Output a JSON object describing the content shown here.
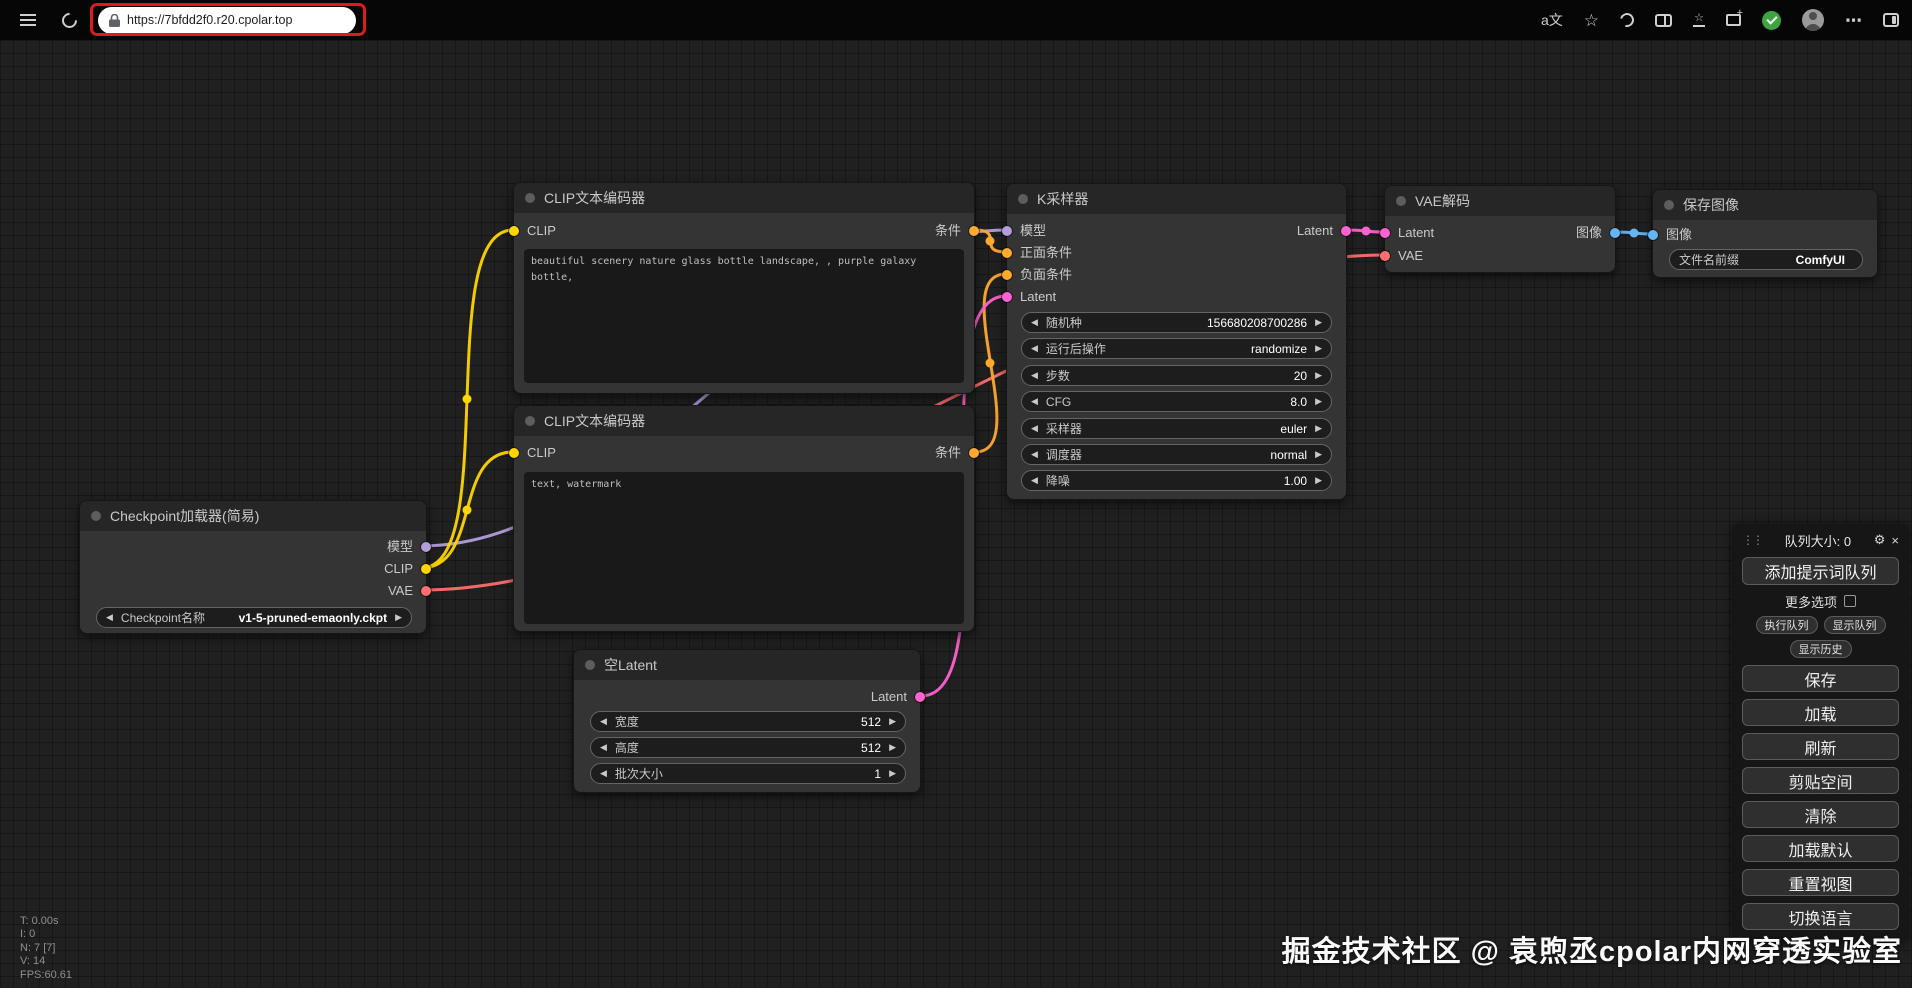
{
  "browser": {
    "url": "https://7bfdd2f0.r20.cpolar.top"
  },
  "glyphs": {
    "arrow_left": "◀",
    "arrow_right": "▶",
    "drag_handle": "⋮⋮",
    "gear": "⚙",
    "close": "×",
    "translate": "a文",
    "star": "☆",
    "more": "⋯"
  },
  "graph": {
    "link_colors": {
      "model": "#B39DDB",
      "clip": "#FFD500",
      "vae": "#FF6E6E",
      "conditioning": "#FFA931",
      "latent": "#FF61D0",
      "image": "#64B5F6"
    },
    "nodes": {
      "checkpoint": {
        "title": "Checkpoint加载器(简易)",
        "outputs": [
          "模型",
          "CLIP",
          "VAE"
        ],
        "widget": {
          "label": "Checkpoint名称",
          "value": "v1-5-pruned-emaonly.ckpt"
        }
      },
      "clip_positive": {
        "title": "CLIP文本编码器",
        "input": "CLIP",
        "output": "条件",
        "text": "beautiful scenery nature glass bottle landscape, , purple galaxy bottle,"
      },
      "clip_negative": {
        "title": "CLIP文本编码器",
        "input": "CLIP",
        "output": "条件",
        "text": "text, watermark"
      },
      "ksampler": {
        "title": "K采样器",
        "inputs": [
          "模型",
          "正面条件",
          "负面条件",
          "Latent"
        ],
        "output": "Latent",
        "widgets": [
          {
            "label": "随机种",
            "value": "156680208700286"
          },
          {
            "label": "运行后操作",
            "value": "randomize"
          },
          {
            "label": "步数",
            "value": "20"
          },
          {
            "label": "CFG",
            "value": "8.0"
          },
          {
            "label": "采样器",
            "value": "euler"
          },
          {
            "label": "调度器",
            "value": "normal"
          },
          {
            "label": "降噪",
            "value": "1.00"
          }
        ]
      },
      "vae_decode": {
        "title": "VAE解码",
        "inputs": [
          "Latent",
          "VAE"
        ],
        "output": "图像"
      },
      "save_image": {
        "title": "保存图像",
        "input": "图像",
        "widget": {
          "label": "文件名前缀",
          "value": "ComfyUI"
        }
      },
      "empty_latent": {
        "title": "空Latent",
        "output": "Latent",
        "widgets": [
          {
            "label": "宽度",
            "value": "512"
          },
          {
            "label": "高度",
            "value": "512"
          },
          {
            "label": "批次大小",
            "value": "1"
          }
        ]
      }
    }
  },
  "menu": {
    "queue_size": "队列大小: 0",
    "queue_prompt": "添加提示词队列",
    "extra_options": "更多选项",
    "queue_front": "执行队列",
    "view_queue": "显示队列",
    "view_history": "显示历史",
    "buttons": [
      "保存",
      "加载",
      "刷新",
      "剪贴空间",
      "清除",
      "加载默认",
      "重置视图",
      "切换语言"
    ]
  },
  "stats": {
    "time": "T: 0.00s",
    "iteration": "I: 0",
    "nodes": "N: 7 [7]",
    "version": "V: 14",
    "fps": "FPS:60.61"
  },
  "watermark": "掘金技术社区 @ 袁煦丞cpolar内网穿透实验室"
}
